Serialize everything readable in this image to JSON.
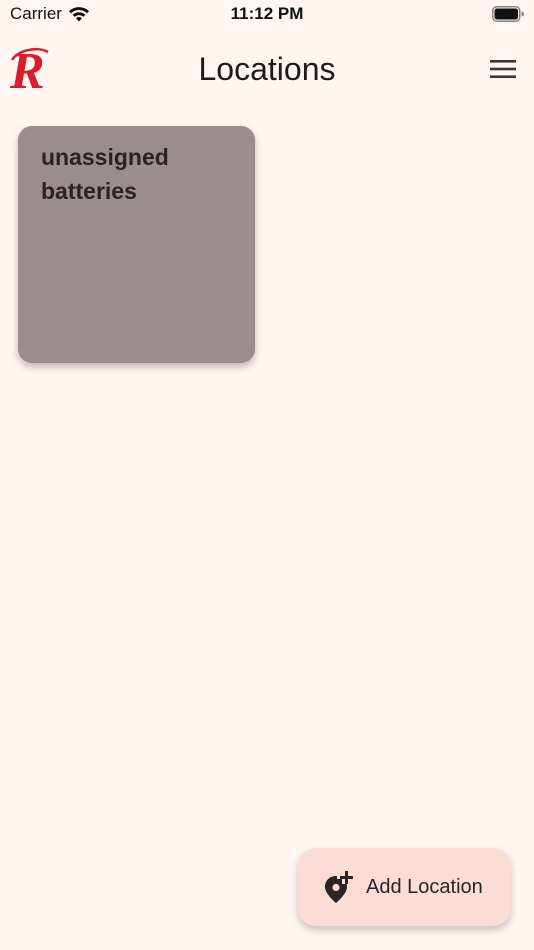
{
  "status_bar": {
    "carrier": "Carrier",
    "time": "11:12 PM",
    "wifi_icon": "wifi-icon",
    "battery_icon": "battery-icon"
  },
  "app_bar": {
    "logo_icon": "r-logo-icon",
    "title": "Locations",
    "menu_icon": "hamburger-menu-icon"
  },
  "locations": [
    {
      "name": "unassigned batteries"
    }
  ],
  "fab": {
    "label": "Add Location",
    "icon": "add-location-pin-icon"
  },
  "colors": {
    "background": "#fff5f3",
    "card": "#978e8d",
    "fab": "#fddcd6",
    "logo": "#d81e2c"
  }
}
